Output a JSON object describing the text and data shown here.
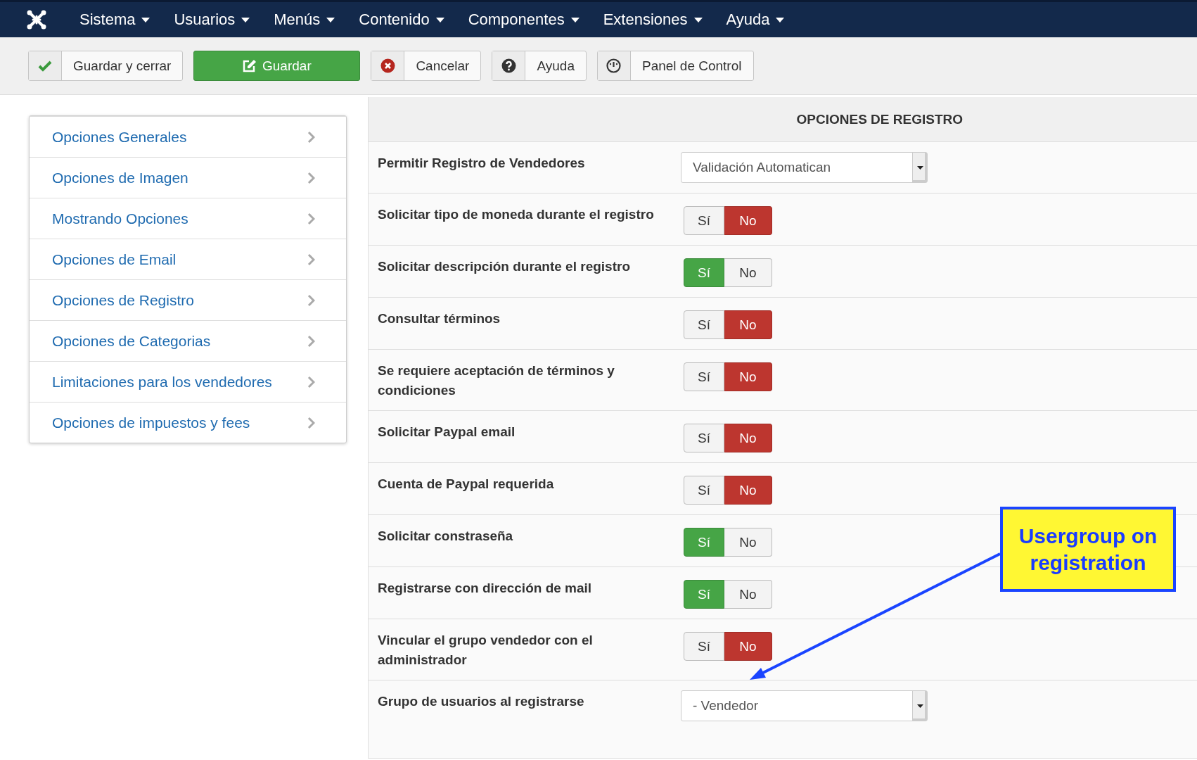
{
  "navbar": {
    "menus": [
      {
        "label": "Sistema"
      },
      {
        "label": "Usuarios"
      },
      {
        "label": "Menús"
      },
      {
        "label": "Contenido"
      },
      {
        "label": "Componentes"
      },
      {
        "label": "Extensiones"
      },
      {
        "label": "Ayuda"
      }
    ]
  },
  "toolbar": {
    "buttons": [
      {
        "label": "Guardar y cerrar",
        "kind": "check"
      },
      {
        "label": "Guardar",
        "kind": "primary"
      },
      {
        "label": "Cancelar",
        "kind": "cancel"
      },
      {
        "label": "Ayuda",
        "kind": "help"
      },
      {
        "label": "Panel de Control",
        "kind": "dashboard"
      }
    ]
  },
  "sidebar": {
    "items": [
      {
        "label": "Opciones Generales"
      },
      {
        "label": "Opciones de Imagen"
      },
      {
        "label": "Mostrando Opciones"
      },
      {
        "label": "Opciones de Email"
      },
      {
        "label": "Opciones de Registro"
      },
      {
        "label": "Opciones de Categorias"
      },
      {
        "label": "Limitaciones para los vendedores"
      },
      {
        "label": "Opciones de impuestos y fees"
      }
    ]
  },
  "panel": {
    "title": "OPCIONES DE REGISTRO",
    "rows": [
      {
        "label": "Permitir Registro de Vendedores",
        "kind": "select",
        "value": "Validación Automatican"
      },
      {
        "label": "Solicitar tipo de moneda durante el registro",
        "kind": "toggle",
        "options": [
          {
            "label": "Sí",
            "selected": false
          },
          {
            "label": "No",
            "selected": true
          }
        ]
      },
      {
        "label": "Solicitar descripción durante el registro",
        "kind": "toggle",
        "options": [
          {
            "label": "Sí",
            "selected": true
          },
          {
            "label": "No",
            "selected": false
          }
        ]
      },
      {
        "label": "Consultar términos",
        "kind": "toggle",
        "options": [
          {
            "label": "Sí",
            "selected": false
          },
          {
            "label": "No",
            "selected": true
          }
        ]
      },
      {
        "label": "Se requiere aceptación de términos y condiciones",
        "kind": "toggle",
        "options": [
          {
            "label": "Sí",
            "selected": false
          },
          {
            "label": "No",
            "selected": true
          }
        ]
      },
      {
        "label": "Solicitar Paypal email",
        "kind": "toggle",
        "options": [
          {
            "label": "Sí",
            "selected": false
          },
          {
            "label": "No",
            "selected": true
          }
        ]
      },
      {
        "label": "Cuenta de Paypal requerida",
        "kind": "toggle",
        "options": [
          {
            "label": "Sí",
            "selected": false
          },
          {
            "label": "No",
            "selected": true
          }
        ]
      },
      {
        "label": "Solicitar constraseña",
        "kind": "toggle",
        "options": [
          {
            "label": "Sí",
            "selected": true
          },
          {
            "label": "No",
            "selected": false
          }
        ]
      },
      {
        "label": "Registrarse con dirección de mail",
        "kind": "toggle",
        "options": [
          {
            "label": "Sí",
            "selected": true
          },
          {
            "label": "No",
            "selected": false
          }
        ]
      },
      {
        "label": "Vincular el grupo vendedor con el administrador",
        "kind": "toggle",
        "options": [
          {
            "label": "Sí",
            "selected": false
          },
          {
            "label": "No",
            "selected": true
          }
        ]
      },
      {
        "label": "Grupo de usuarios al registrarse",
        "kind": "select",
        "value": "- Vendedor"
      }
    ]
  },
  "annotation": {
    "text": "Usergroup on registration"
  }
}
